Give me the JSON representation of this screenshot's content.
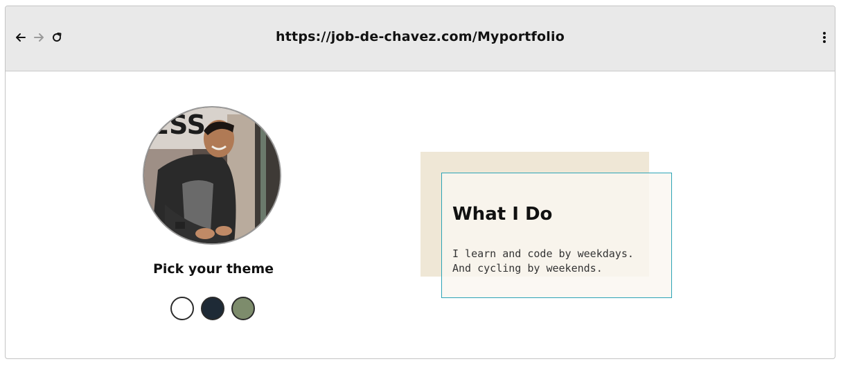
{
  "browser": {
    "url": "https://job-de-chavez.com/Myportfolio",
    "icons": {
      "back": "arrow-left-icon",
      "forward": "arrow-right-icon",
      "reload": "reload-icon",
      "menu": "kebab-menu-icon"
    }
  },
  "profile": {
    "photo": "profile-photo"
  },
  "theme_picker": {
    "title": "Pick your theme",
    "options": [
      {
        "name": "light",
        "color": "#ffffff"
      },
      {
        "name": "dark",
        "color": "#1e2a36"
      },
      {
        "name": "green",
        "color": "#7d8c6c"
      }
    ]
  },
  "about": {
    "heading": "What I Do",
    "line1": "I learn and code by weekdays.",
    "line2": "And cycling by weekends."
  },
  "colors": {
    "toolbar_bg": "#e9e9e9",
    "card_accent": "#2ba3b6",
    "card_back": "#efe7d6"
  }
}
